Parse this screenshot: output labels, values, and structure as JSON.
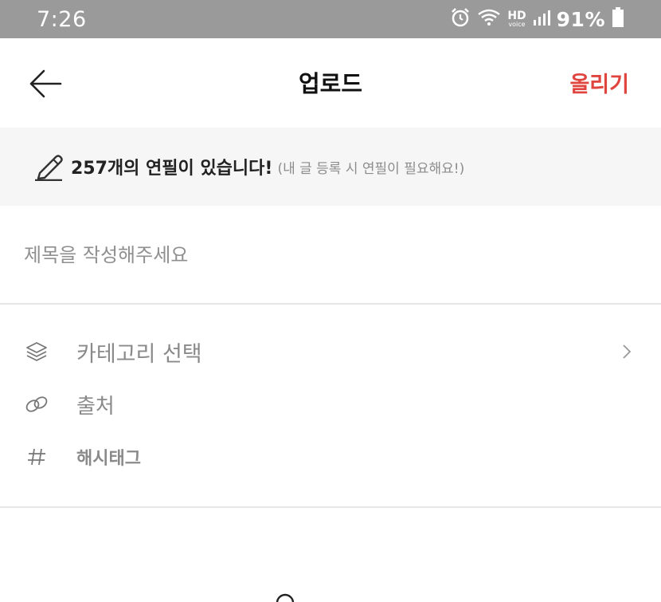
{
  "status_bar": {
    "time": "7:26",
    "hd_label": "HD",
    "voice_label": "voice",
    "battery": "91%"
  },
  "header": {
    "title": "업로드",
    "upload_label": "올리기",
    "accent_color": "#e0443e"
  },
  "notice": {
    "main_text": "257개의 연필이 있습니다!",
    "sub_text": "(내 글 등록 시 연필이 필요해요!)"
  },
  "title_field": {
    "placeholder": "제목을 작성해주세요",
    "value": ""
  },
  "options": {
    "category": {
      "label": "카테고리 선택",
      "icon": "layers-icon"
    },
    "source": {
      "label": "출처",
      "icon": "link-icon"
    },
    "hashtag": {
      "label": "해시태그",
      "icon": "hash-icon"
    }
  }
}
